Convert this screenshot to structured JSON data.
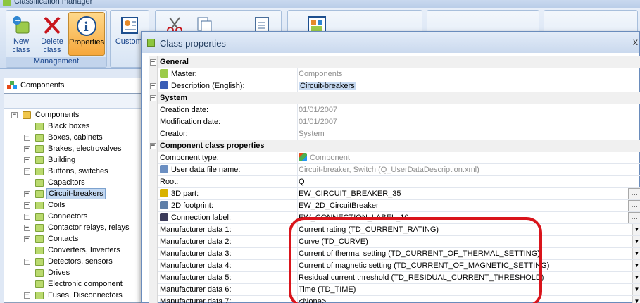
{
  "app": {
    "title": "Classification manager"
  },
  "ribbon": {
    "new_class": "New class",
    "delete_class": "Delete class",
    "properties": "Properties",
    "customize": "Customi",
    "group_management": "Management"
  },
  "left": {
    "combo_value": "Components",
    "tree": [
      {
        "label": "Components",
        "level": 0,
        "expander": "−"
      },
      {
        "label": "Black boxes",
        "level": 1,
        "expander": ""
      },
      {
        "label": "Boxes, cabinets",
        "level": 1,
        "expander": "+"
      },
      {
        "label": "Brakes, electrovalves",
        "level": 1,
        "expander": "+"
      },
      {
        "label": "Building",
        "level": 1,
        "expander": "+"
      },
      {
        "label": "Buttons, switches",
        "level": 1,
        "expander": "+"
      },
      {
        "label": "Capacitors",
        "level": 1,
        "expander": ""
      },
      {
        "label": "Circuit-breakers",
        "level": 1,
        "expander": "+",
        "selected": true
      },
      {
        "label": "Coils",
        "level": 1,
        "expander": "+"
      },
      {
        "label": "Connectors",
        "level": 1,
        "expander": "+"
      },
      {
        "label": "Contactor relays, relays",
        "level": 1,
        "expander": "+"
      },
      {
        "label": "Contacts",
        "level": 1,
        "expander": "+"
      },
      {
        "label": "Converters, Inverters",
        "level": 1,
        "expander": ""
      },
      {
        "label": "Detectors, sensors",
        "level": 1,
        "expander": "+"
      },
      {
        "label": "Drives",
        "level": 1,
        "expander": ""
      },
      {
        "label": "Electronic component",
        "level": 1,
        "expander": ""
      },
      {
        "label": "Fuses, Disconnectors",
        "level": 1,
        "expander": "+"
      }
    ]
  },
  "dialog": {
    "title": "Class properties",
    "close": "x",
    "rows": [
      {
        "kind": "cat",
        "name": "General",
        "pm": "−"
      },
      {
        "kind": "prop",
        "name": "Master:",
        "value": "Components",
        "gray": true,
        "icon": "folder-icon"
      },
      {
        "kind": "prop",
        "name": "Description (English):",
        "value": "Circuit-breakers",
        "pm": "+",
        "icon": "flag-icon",
        "edit": true
      },
      {
        "kind": "cat",
        "name": "System",
        "pm": "−"
      },
      {
        "kind": "prop",
        "name": "Creation date:",
        "value": "01/01/2007",
        "gray": true
      },
      {
        "kind": "prop",
        "name": "Modification date:",
        "value": "01/01/2007",
        "gray": true
      },
      {
        "kind": "prop",
        "name": "Creator:",
        "value": "System",
        "gray": true
      },
      {
        "kind": "cat",
        "name": "Component class properties",
        "pm": "−"
      },
      {
        "kind": "prop",
        "name": "Component type:",
        "value": "Component",
        "gray": true,
        "valicon": true
      },
      {
        "kind": "prop",
        "name": "User data file name:",
        "value": "Circuit-breaker, Switch (Q_UserDataDescription.xml)",
        "gray": true,
        "icon": "user-data-icon"
      },
      {
        "kind": "prop",
        "name": "Root:",
        "value": "Q"
      },
      {
        "kind": "prop",
        "name": "3D part:",
        "value": "EW_CIRCUIT_BREAKER_35",
        "icon": "3d-part-icon",
        "btn": "..."
      },
      {
        "kind": "prop",
        "name": "2D footprint:",
        "value": "EW_2D_CircuitBreaker",
        "icon": "2d-footprint-icon",
        "btn": "..."
      },
      {
        "kind": "prop",
        "name": "Connection label:",
        "value": "EW_CONNECTION_LABEL_10",
        "icon": "connection-label-icon",
        "btn": "..."
      },
      {
        "kind": "prop",
        "name": "Manufacturer data 1:",
        "value": "Current rating (TD_CURRENT_RATING)",
        "dd": true
      },
      {
        "kind": "prop",
        "name": "Manufacturer data 2:",
        "value": "Curve (TD_CURVE)",
        "dd": true
      },
      {
        "kind": "prop",
        "name": "Manufacturer data 3:",
        "value": "Current of thermal setting (TD_CURRENT_OF_THERMAL_SETTING)",
        "dd": true
      },
      {
        "kind": "prop",
        "name": "Manufacturer data 4:",
        "value": "Current of magnetic setting (TD_CURRENT_OF_MAGNETIC_SETTING)",
        "dd": true
      },
      {
        "kind": "prop",
        "name": "Manufacturer data 5:",
        "value": "Residual current threshold (TD_RESIDUAL_CURRENT_THRESHOLD)",
        "dd": true
      },
      {
        "kind": "prop",
        "name": "Manufacturer data 6:",
        "value": "Time (TD_TIME)",
        "dd": true
      },
      {
        "kind": "prop",
        "name": "Manufacturer data 7:",
        "value": "<None>",
        "dd": true
      }
    ]
  },
  "colors": {
    "highlight": "#d9141b",
    "selection": "#c2d8f2",
    "accent": "#15428b"
  }
}
